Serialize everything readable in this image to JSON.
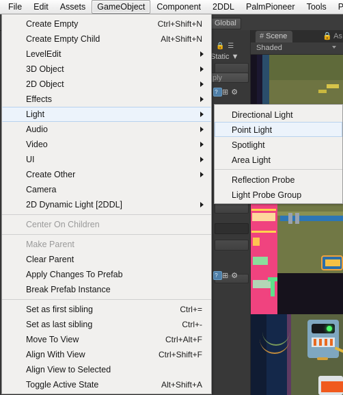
{
  "menubar": {
    "items": [
      {
        "label": "File",
        "active": false
      },
      {
        "label": "Edit",
        "active": false
      },
      {
        "label": "Assets",
        "active": false
      },
      {
        "label": "GameObject",
        "active": true
      },
      {
        "label": "Component",
        "active": false
      },
      {
        "label": "2DDL",
        "active": false
      },
      {
        "label": "PalmPioneer",
        "active": false
      },
      {
        "label": "Tools",
        "active": false
      },
      {
        "label": "Palml",
        "active": false
      }
    ]
  },
  "gameobject_menu": {
    "items": [
      {
        "label": "Create Empty",
        "accel": "Ctrl+Shift+N",
        "arrow": false,
        "disabled": false,
        "selected": false
      },
      {
        "label": "Create Empty Child",
        "accel": "Alt+Shift+N",
        "arrow": false,
        "disabled": false,
        "selected": false
      },
      {
        "label": "LevelEdit",
        "accel": "",
        "arrow": true,
        "disabled": false,
        "selected": false
      },
      {
        "label": "3D Object",
        "accel": "",
        "arrow": true,
        "disabled": false,
        "selected": false
      },
      {
        "label": "2D Object",
        "accel": "",
        "arrow": true,
        "disabled": false,
        "selected": false
      },
      {
        "label": "Effects",
        "accel": "",
        "arrow": true,
        "disabled": false,
        "selected": false
      },
      {
        "label": "Light",
        "accel": "",
        "arrow": true,
        "disabled": false,
        "selected": true
      },
      {
        "label": "Audio",
        "accel": "",
        "arrow": true,
        "disabled": false,
        "selected": false
      },
      {
        "label": "Video",
        "accel": "",
        "arrow": true,
        "disabled": false,
        "selected": false
      },
      {
        "label": "UI",
        "accel": "",
        "arrow": true,
        "disabled": false,
        "selected": false
      },
      {
        "label": "Create Other",
        "accel": "",
        "arrow": true,
        "disabled": false,
        "selected": false
      },
      {
        "label": "Camera",
        "accel": "",
        "arrow": false,
        "disabled": false,
        "selected": false
      },
      {
        "label": "2D Dynamic Light [2DDL]",
        "accel": "",
        "arrow": true,
        "disabled": false,
        "selected": false
      },
      {
        "separator": true
      },
      {
        "label": "Center On Children",
        "accel": "",
        "arrow": false,
        "disabled": true,
        "selected": false
      },
      {
        "separator": true
      },
      {
        "label": "Make Parent",
        "accel": "",
        "arrow": false,
        "disabled": true,
        "selected": false
      },
      {
        "label": "Clear Parent",
        "accel": "",
        "arrow": false,
        "disabled": false,
        "selected": false
      },
      {
        "label": "Apply Changes To Prefab",
        "accel": "",
        "arrow": false,
        "disabled": false,
        "selected": false
      },
      {
        "label": "Break Prefab Instance",
        "accel": "",
        "arrow": false,
        "disabled": false,
        "selected": false
      },
      {
        "separator": true
      },
      {
        "label": "Set as first sibling",
        "accel": "Ctrl+=",
        "arrow": false,
        "disabled": false,
        "selected": false
      },
      {
        "label": "Set as last sibling",
        "accel": "Ctrl+-",
        "arrow": false,
        "disabled": false,
        "selected": false
      },
      {
        "label": "Move To View",
        "accel": "Ctrl+Alt+F",
        "arrow": false,
        "disabled": false,
        "selected": false
      },
      {
        "label": "Align With View",
        "accel": "Ctrl+Shift+F",
        "arrow": false,
        "disabled": false,
        "selected": false
      },
      {
        "label": "Align View to Selected",
        "accel": "",
        "arrow": false,
        "disabled": false,
        "selected": false
      },
      {
        "label": "Toggle Active State",
        "accel": "Alt+Shift+A",
        "arrow": false,
        "disabled": false,
        "selected": false
      }
    ]
  },
  "light_submenu": {
    "items": [
      {
        "label": "Directional Light",
        "selected": false
      },
      {
        "label": "Point Light",
        "selected": true
      },
      {
        "label": "Spotlight",
        "selected": false
      },
      {
        "label": "Area Light",
        "selected": false
      },
      {
        "separator": true
      },
      {
        "label": "Reflection Probe",
        "selected": false
      },
      {
        "label": "Light Probe Group",
        "selected": false
      }
    ]
  },
  "editor_background": {
    "global_button": "Global",
    "static_label": "Static",
    "apply_button": "ply",
    "scene_tab": "Scene",
    "scene_tab_icon": "hash-grid-icon",
    "second_tab": "As",
    "shading_mode": "Shaded",
    "help_icon": "?",
    "layers_icon": "layers-icon",
    "gear_icon": "gear-icon",
    "lock_icon": "lock-icon"
  },
  "colors": {
    "menu_bg": "#f1f0ee",
    "menu_border": "#9d9d9d",
    "highlight_bg": "#ecf3fb",
    "highlight_border": "#b8d2ee",
    "menubar_text": "#101010",
    "disabled_text": "#9a9a9a",
    "editor_dark": "#383838",
    "editor_panel": "#3c3c3c"
  }
}
